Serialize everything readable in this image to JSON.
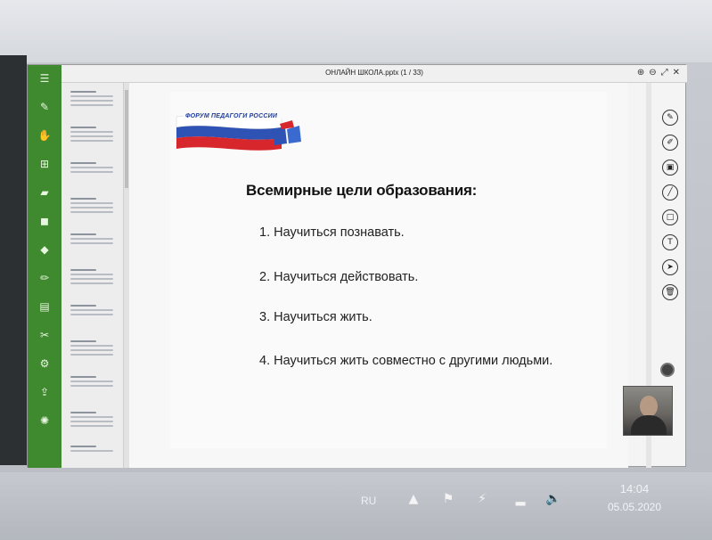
{
  "window": {
    "title": "ОНЛАЙН ШКОЛА.pptx (1 / 33)",
    "controls": [
      "⊕",
      "⊖",
      "⤢",
      "✕"
    ]
  },
  "left_toolbar": {
    "icons": [
      "menu-icon",
      "pen-icon",
      "hand-icon",
      "page-plus-icon",
      "eraser-icon",
      "shapes-icon",
      "text-icon",
      "pencil-icon",
      "document-icon",
      "scissors-icon",
      "settings-icon",
      "share-icon",
      "gear-icon"
    ]
  },
  "slide": {
    "logo_text": "ФОРУМ ПЕДАГОГИ РОССИИ",
    "heading": "Всемирные цели образования:",
    "goals": [
      "1.   Научиться познавать.",
      "2.  Научиться действовать.",
      "3. Научиться жить.",
      "4.  Научиться  жить  совместно    с  другими людьми."
    ]
  },
  "right_tools": [
    "pen-tool-icon",
    "marker-tool-icon",
    "highlighter-tool-icon",
    "line-tool-icon",
    "rectangle-tool-icon",
    "text-tool-icon",
    "pointer-tool-icon",
    "delete-tool-icon"
  ],
  "taskbar": {
    "language": "RU",
    "time": "14:04",
    "date": "05.05.2020"
  },
  "colors": {
    "toolbar_green": "#3f8a2e",
    "flag_white": "#ffffff",
    "flag_blue": "#2f53b4",
    "flag_red": "#d7262c"
  }
}
